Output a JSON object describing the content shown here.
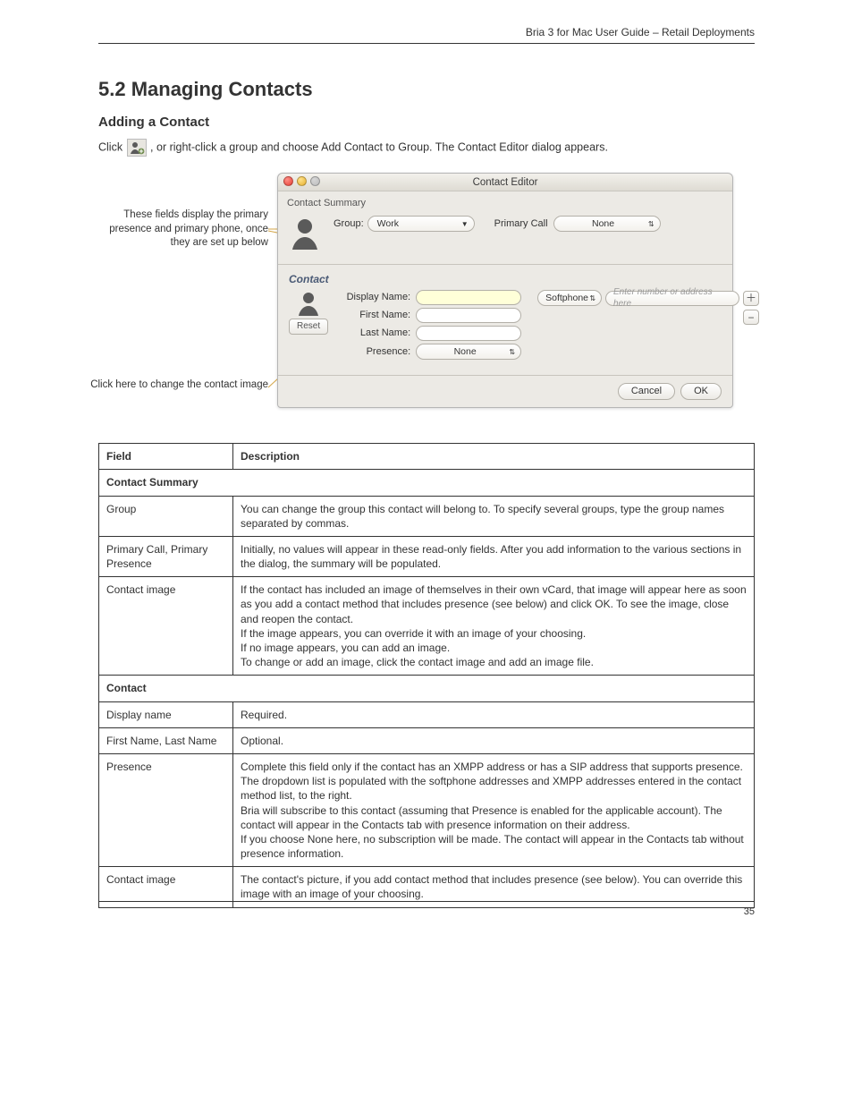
{
  "header": {
    "running_title": "Bria 3 for Mac User Guide – Retail Deployments"
  },
  "section": {
    "title": "5.2 Managing Contacts",
    "subheading": "Adding a Contact",
    "intro_pre": "Click ",
    "intro_post": ", or right-click a group and choose Add Contact to Group. The Contact Editor dialog appears."
  },
  "callouts": {
    "display_primary": "These fields display the primary presence and primary phone, once they are set up below",
    "change_image": "Click here to change the contact image"
  },
  "window": {
    "title": "Contact Editor",
    "summary_label": "Contact Summary",
    "group_label": "Group:",
    "group_value": "Work",
    "primary_call_label": "Primary Call",
    "primary_call_value": "None",
    "section_title": "Contact",
    "display_name_label": "Display Name:",
    "first_name_label": "First Name:",
    "last_name_label": "Last Name:",
    "presence_label": "Presence:",
    "presence_value": "None",
    "reset_label": "Reset",
    "softphone_label": "Softphone",
    "address_placeholder": "Enter number or address here",
    "cancel": "Cancel",
    "ok": "OK"
  },
  "table": {
    "head_field": "Field",
    "head_desc": "Description",
    "section1": "Contact Summary",
    "r1_field": "Group",
    "r1_desc": "You can change the group this contact will belong to. To specify several groups, type the group names separated by commas.",
    "r2_field": "Primary Call, Primary Presence",
    "r2_desc": "Initially, no values will appear in these read-only fields. After you add information to the various sections in the dialog, the summary will be populated.",
    "r3_field": "Contact image",
    "r3_desc_p1": "If the contact has included an image of themselves in their own vCard, that image will appear here as soon as you add a contact method that includes presence (see below) and click OK. To see the image, close and reopen the contact.",
    "r3_desc_p2": "If the image appears, you can override it with an image of your choosing.",
    "r3_desc_p3": "If no image appears, you can add an image.",
    "r3_desc_p4": "To change or add an image, click the contact image and add an image file.",
    "section2": "Contact",
    "r4_field": "Display name",
    "r4_desc": "Required.",
    "r5_field": "First Name, Last Name",
    "r5_desc": "Optional.",
    "r6_field": "Presence",
    "r6_desc_p1": "Complete this field only if the contact has an XMPP address or has a SIP address that supports presence.",
    "r6_desc_p2": "The dropdown list is populated with the softphone addresses and XMPP addresses entered in the contact method list, to the right.",
    "r6_desc_p3": "Bria will subscribe to this contact (assuming that Presence is enabled for the applicable account). The contact will appear in the Contacts tab with presence information on their address.",
    "r6_desc_p4": "If you choose None here, no subscription will be made. The contact will appear in the Contacts tab without presence information.",
    "r7_field": "Contact image",
    "r7_desc": "The contact's picture, if you add contact method that includes presence (see below). You can override this image with an image of your choosing."
  },
  "footer": {
    "page_number": "35"
  }
}
